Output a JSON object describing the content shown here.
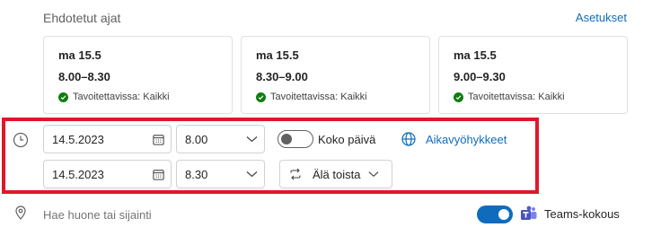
{
  "header": {
    "title": "Ehdotetut ajat",
    "settings_label": "Asetukset"
  },
  "suggestions": [
    {
      "day": "ma 15.5",
      "time": "8.00–8.30",
      "availability": "Tavoitettavissa: Kaikki"
    },
    {
      "day": "ma 15.5",
      "time": "8.30–9.00",
      "availability": "Tavoitettavissa: Kaikki"
    },
    {
      "day": "ma 15.5",
      "time": "9.00–9.30",
      "availability": "Tavoitettavissa: Kaikki"
    }
  ],
  "start": {
    "date": "14.5.2023",
    "time": "8.00"
  },
  "end": {
    "date": "14.5.2023",
    "time": "8.30"
  },
  "all_day": {
    "label": "Koko päivä",
    "on": false
  },
  "timezones_label": "Aikavyöhykkeet",
  "repeat_label": "Älä toista",
  "location": {
    "placeholder": "Hae huone tai sijainti",
    "value": ""
  },
  "teams": {
    "label": "Teams-kokous",
    "on": true
  },
  "colors": {
    "accent": "#0f6cbd",
    "highlight": "#e0172a",
    "available": "#107c10"
  }
}
